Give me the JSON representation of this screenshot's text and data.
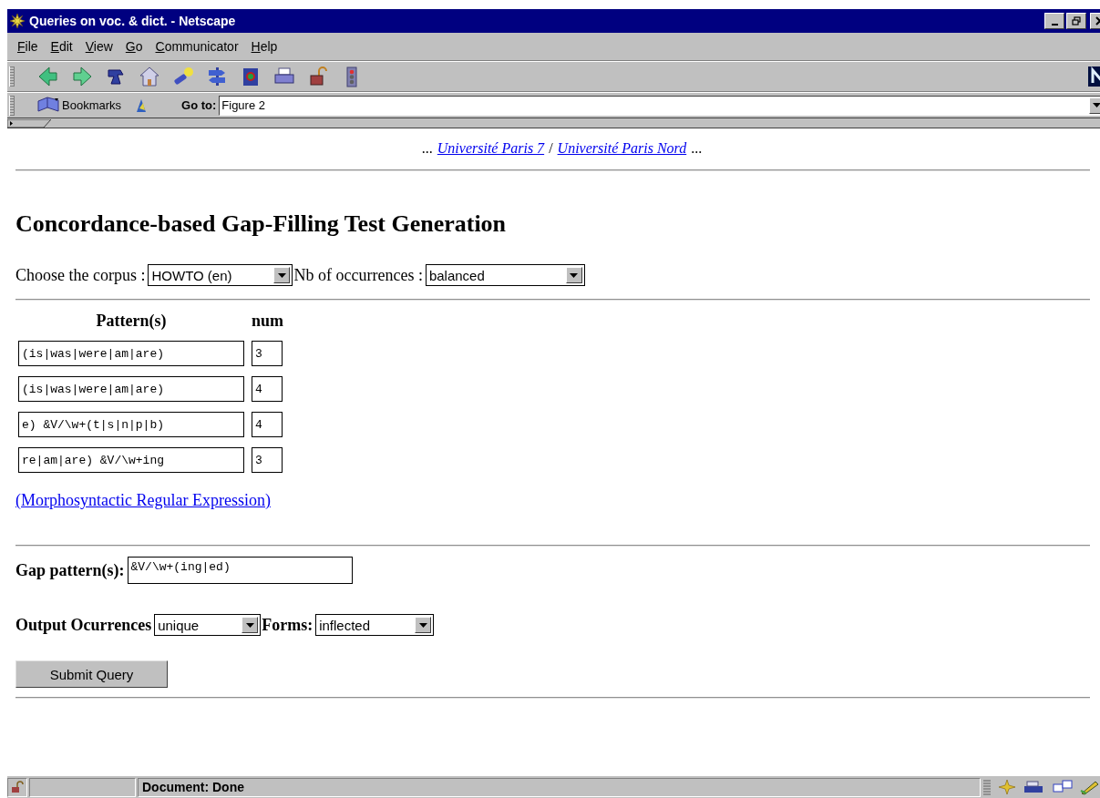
{
  "window": {
    "title": "Queries on voc. & dict. - Netscape"
  },
  "menu": [
    "File",
    "Edit",
    "View",
    "Go",
    "Communicator",
    "Help"
  ],
  "location_bar": {
    "bookmarks": "Bookmarks",
    "goto_label": "Go to:",
    "url": "Figure 2"
  },
  "page": {
    "top_links": {
      "prefix": "...",
      "links": [
        "Université Paris 7",
        "Université Paris Nord"
      ],
      "separator": "/",
      "suffix": "..."
    },
    "heading": "Concordance-based Gap-Filling Test Generation",
    "corpus": {
      "label": "Choose the corpus :",
      "value": "HOWTO (en)"
    },
    "occurrences": {
      "label": "Nb of occurrences :",
      "value": "balanced"
    },
    "pattern_table": {
      "columns": [
        "Pattern(s)",
        "num"
      ],
      "rows": [
        {
          "pattern": "(is|was|were|am|are)",
          "num": "3"
        },
        {
          "pattern": "(is|was|were|am|are)",
          "num": "4"
        },
        {
          "pattern": "e) &V/\\w+(t|s|n|p|b)",
          "num": "4"
        },
        {
          "pattern": "re|am|are) &V/\\w+ing",
          "num": "3"
        }
      ]
    },
    "help_link": "(Morphosyntactic Regular Expression)",
    "gap_pattern": {
      "label": "Gap pattern(s):",
      "value": "&V/\\w+(ing|ed)"
    },
    "output": {
      "label": "Output Ocurrences",
      "value": "unique"
    },
    "forms": {
      "label": "Forms:",
      "value": "inflected"
    },
    "submit": "Submit Query"
  },
  "status_bar": {
    "text": "Document: Done"
  }
}
